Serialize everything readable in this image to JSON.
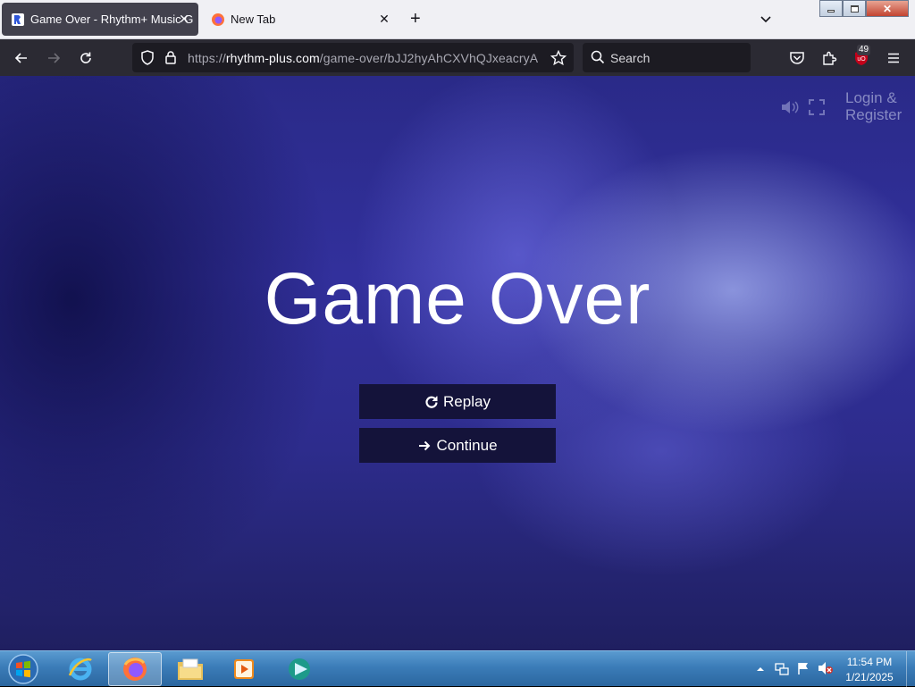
{
  "browser": {
    "tabs": [
      {
        "title": "Game Over - Rhythm+ Music G",
        "active": true
      },
      {
        "title": "New Tab",
        "active": false
      }
    ],
    "url": {
      "protocol": "https://",
      "domain": "rhythm-plus.com",
      "path": "/game-over/bJJ2hyAhCXVhQJxeacryA"
    },
    "search_placeholder": "Search",
    "extensions_badge": "49"
  },
  "page": {
    "title": "Game Over",
    "buttons": {
      "replay": "Replay",
      "continue": "Continue"
    },
    "login": {
      "line1": "Login &",
      "line2": "Register"
    }
  },
  "taskbar": {
    "apps": [
      "internet-explorer",
      "firefox",
      "file-explorer",
      "media-player",
      "app"
    ],
    "clock": {
      "time": "11:54 PM",
      "date": "1/21/2025"
    }
  },
  "colors": {
    "tab_active_bg": "#42414d",
    "toolbar_bg": "#2b2a33",
    "urlbar_bg": "#1c1b22",
    "page_bg_base": "#2d2c8c",
    "button_bg": "#14133a",
    "taskbar": "#3b7cb8"
  }
}
